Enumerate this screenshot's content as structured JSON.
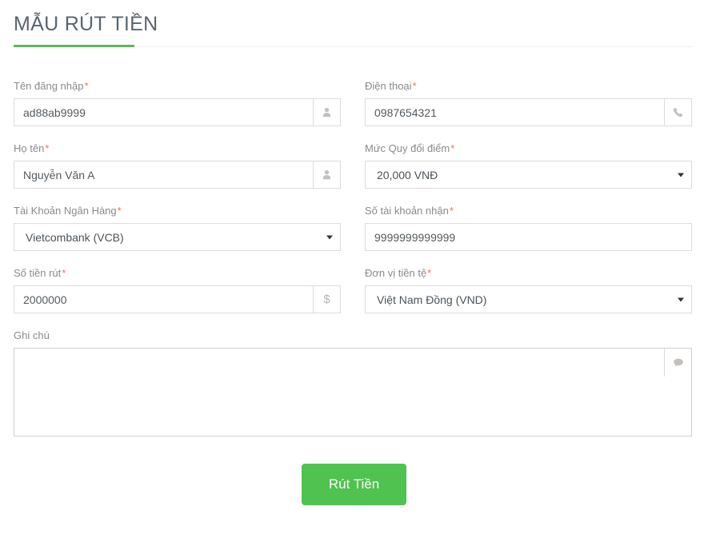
{
  "header": {
    "title": "MẪU RÚT TIỀN",
    "accent_color": "#5cb85c",
    "title_color": "#596570"
  },
  "theme": {
    "required_marker": "*",
    "required_color": "#e8755f",
    "label_color": "#8a8a8a",
    "border_color": "#dcdcdc",
    "button_color": "#4fc24f",
    "input_text_color": "#555a5e"
  },
  "form": {
    "fields": {
      "username": {
        "label": "Tên đăng nhập",
        "required": true,
        "value": "ad88ab9999",
        "placeholder": "",
        "addon_icon": "user-icon"
      },
      "phone": {
        "label": "Điện thoại",
        "required": true,
        "value": "0987654321",
        "placeholder": "",
        "addon_icon": "phone-icon"
      },
      "fullname": {
        "label": "Họ tên",
        "required": true,
        "value": "Nguyễn Văn A",
        "placeholder": "",
        "addon_icon": "user-icon"
      },
      "point_rate": {
        "label": "Mức Quy đổi điểm",
        "required": true,
        "selected": "20,000 VNĐ"
      },
      "bank_account": {
        "label": "Tài Khoản Ngân Hàng",
        "required": true,
        "selected": "Vietcombank (VCB)"
      },
      "receiving_account": {
        "label": "Số tài khoản nhận",
        "required": true,
        "value": "9999999999999",
        "placeholder": ""
      },
      "amount": {
        "label": "Số tiền rút",
        "required": true,
        "value": "2000000",
        "placeholder": "",
        "addon_icon": "dollar-icon",
        "addon_text": "$"
      },
      "currency": {
        "label": "Đơn vị tiền tệ",
        "required": true,
        "selected": "Việt Nam Đồng (VND)"
      },
      "note": {
        "label": "Ghi chú",
        "required": false,
        "value": "",
        "placeholder": "",
        "addon_icon": "comment-icon"
      }
    },
    "submit_label": "Rút Tiền"
  }
}
